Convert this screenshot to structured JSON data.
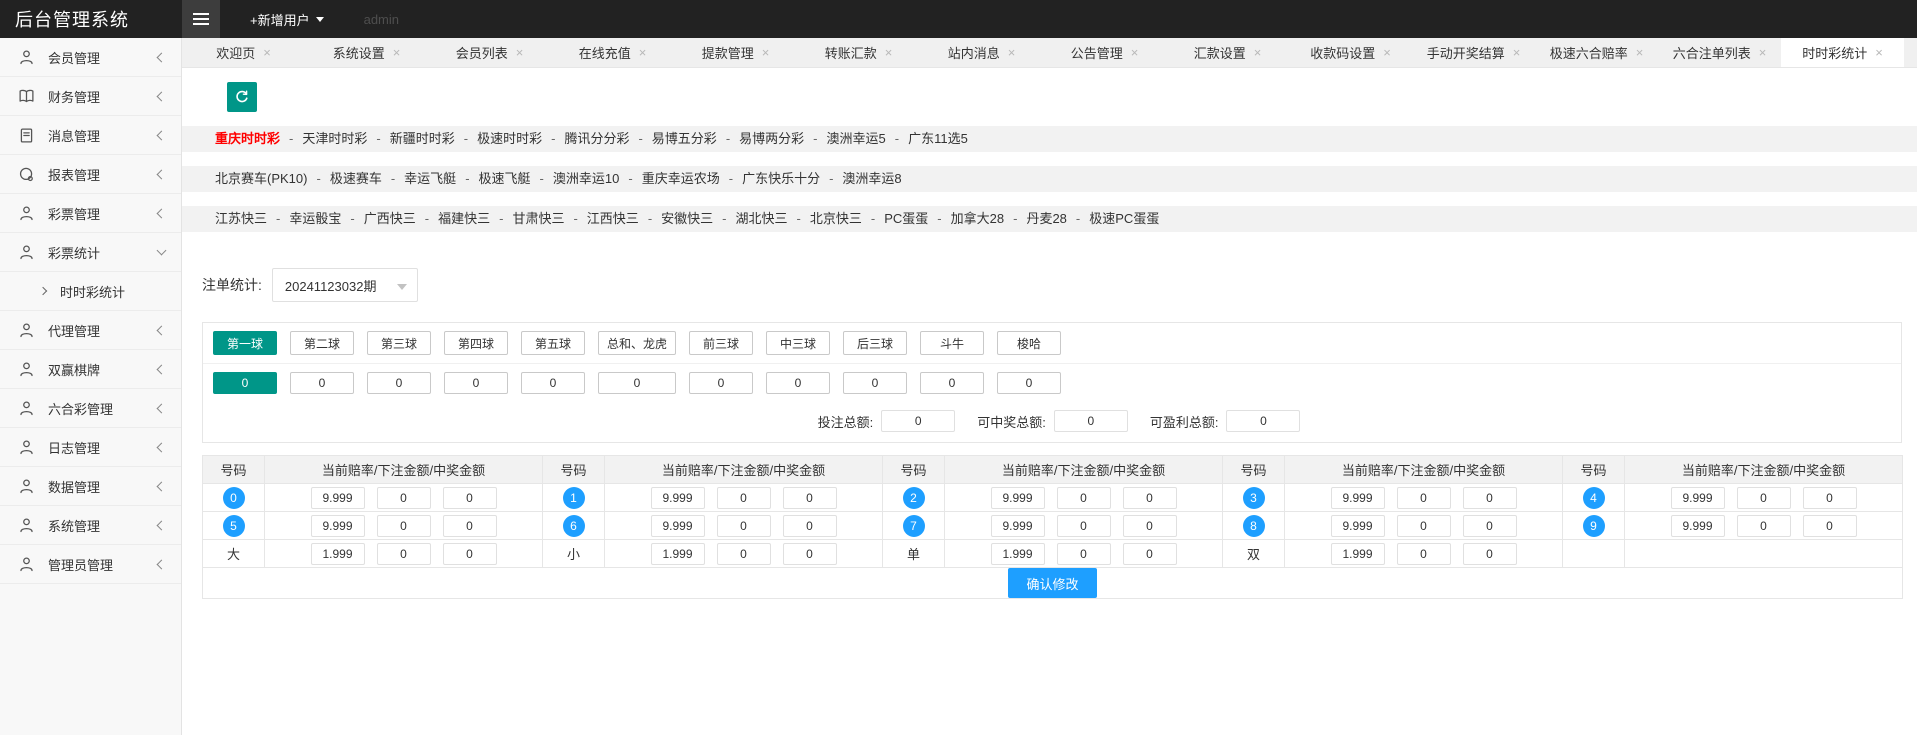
{
  "colors": {
    "accent_teal": "#009688",
    "accent_blue": "#1E9FFF",
    "active_red": "#ff0000",
    "header_bg": "#222222"
  },
  "header": {
    "title": "后台管理系统",
    "add_user_label": "+新增用户",
    "username": "admin"
  },
  "sidebar": {
    "items": [
      {
        "label": "会员管理",
        "icon": "user-icon",
        "state": "collapsed"
      },
      {
        "label": "财务管理",
        "icon": "book-icon",
        "state": "collapsed"
      },
      {
        "label": "消息管理",
        "icon": "file-icon",
        "state": "collapsed"
      },
      {
        "label": "报表管理",
        "icon": "chart-icon",
        "state": "collapsed"
      },
      {
        "label": "彩票管理",
        "icon": "user-icon",
        "state": "collapsed"
      },
      {
        "label": "彩票统计",
        "icon": "user-icon",
        "state": "expanded",
        "children": [
          {
            "label": "时时彩统计"
          }
        ]
      },
      {
        "label": "代理管理",
        "icon": "user-icon",
        "state": "collapsed"
      },
      {
        "label": "双赢棋牌",
        "icon": "user-icon",
        "state": "collapsed"
      },
      {
        "label": "六合彩管理",
        "icon": "user-icon",
        "state": "collapsed"
      },
      {
        "label": "日志管理",
        "icon": "user-icon",
        "state": "collapsed"
      },
      {
        "label": "数据管理",
        "icon": "user-icon",
        "state": "collapsed"
      },
      {
        "label": "系统管理",
        "icon": "user-icon",
        "state": "collapsed"
      },
      {
        "label": "管理员管理",
        "icon": "user-icon",
        "state": "collapsed"
      }
    ]
  },
  "tab_bar": {
    "tabs": [
      {
        "label": "欢迎页",
        "active": false
      },
      {
        "label": "系统设置",
        "active": false
      },
      {
        "label": "会员列表",
        "active": false
      },
      {
        "label": "在线充值",
        "active": false
      },
      {
        "label": "提款管理",
        "active": false
      },
      {
        "label": "转账汇款",
        "active": false
      },
      {
        "label": "站内消息",
        "active": false
      },
      {
        "label": "公告管理",
        "active": false
      },
      {
        "label": "汇款设置",
        "active": false
      },
      {
        "label": "收款码设置",
        "active": false
      },
      {
        "label": "手动开奖结算",
        "active": false
      },
      {
        "label": "极速六合赔率",
        "active": false
      },
      {
        "label": "六合注单列表",
        "active": false
      },
      {
        "label": "时时彩统计",
        "active": true
      }
    ],
    "close_glyph": "×"
  },
  "lottery_nav": {
    "separator": "-",
    "rows": [
      {
        "active": "重庆时时彩",
        "links": [
          "重庆时时彩",
          "天津时时彩",
          "新疆时时彩",
          "极速时时彩",
          "腾讯分分彩",
          "易博五分彩",
          "易博两分彩",
          "澳洲幸运5",
          "广东11选5"
        ]
      },
      {
        "active": null,
        "links": [
          "北京赛车(PK10)",
          "极速赛车",
          "幸运飞艇",
          "极速飞艇",
          "澳洲幸运10",
          "重庆幸运农场",
          "广东快乐十分",
          "澳洲幸运8"
        ]
      },
      {
        "active": null,
        "links": [
          "江苏快三",
          "幸运骰宝",
          "广西快三",
          "福建快三",
          "甘肃快三",
          "江西快三",
          "安徽快三",
          "湖北快三",
          "北京快三",
          "PC蛋蛋",
          "加拿大28",
          "丹麦28",
          "极速PC蛋蛋"
        ]
      }
    ]
  },
  "period": {
    "label": "注单统计:",
    "selected": "20241123032期"
  },
  "ball_panel": {
    "tabs": [
      "第一球",
      "第二球",
      "第三球",
      "第四球",
      "第五球",
      "总和、龙虎",
      "前三球",
      "中三球",
      "后三球",
      "斗牛",
      "梭哈"
    ],
    "active_index": 0,
    "totals": [
      "0",
      "0",
      "0",
      "0",
      "0",
      "0",
      "0",
      "0",
      "0",
      "0",
      "0"
    ],
    "summary": [
      {
        "label": "投注总额:",
        "value": "0"
      },
      {
        "label": "可中奖总额:",
        "value": "0"
      },
      {
        "label": "可盈利总额:",
        "value": "0"
      }
    ]
  },
  "odds_table": {
    "col_headers": {
      "number": "号码",
      "odds": "当前赔率/下注金额/中奖金额"
    },
    "rows": [
      [
        {
          "num": "0",
          "badge": true,
          "odds": "9.999",
          "bet": "0",
          "win": "0"
        },
        {
          "num": "1",
          "badge": true,
          "odds": "9.999",
          "bet": "0",
          "win": "0"
        },
        {
          "num": "2",
          "badge": true,
          "odds": "9.999",
          "bet": "0",
          "win": "0"
        },
        {
          "num": "3",
          "badge": true,
          "odds": "9.999",
          "bet": "0",
          "win": "0"
        },
        {
          "num": "4",
          "badge": true,
          "odds": "9.999",
          "bet": "0",
          "win": "0"
        }
      ],
      [
        {
          "num": "5",
          "badge": true,
          "odds": "9.999",
          "bet": "0",
          "win": "0"
        },
        {
          "num": "6",
          "badge": true,
          "odds": "9.999",
          "bet": "0",
          "win": "0"
        },
        {
          "num": "7",
          "badge": true,
          "odds": "9.999",
          "bet": "0",
          "win": "0"
        },
        {
          "num": "8",
          "badge": true,
          "odds": "9.999",
          "bet": "0",
          "win": "0"
        },
        {
          "num": "9",
          "badge": true,
          "odds": "9.999",
          "bet": "0",
          "win": "0"
        }
      ],
      [
        {
          "num": "大",
          "badge": false,
          "odds": "1.999",
          "bet": "0",
          "win": "0"
        },
        {
          "num": "小",
          "badge": false,
          "odds": "1.999",
          "bet": "0",
          "win": "0"
        },
        {
          "num": "单",
          "badge": false,
          "odds": "1.999",
          "bet": "0",
          "win": "0"
        },
        {
          "num": "双",
          "badge": false,
          "odds": "1.999",
          "bet": "0",
          "win": "0"
        },
        null
      ]
    ],
    "confirm_button": "确认修改"
  }
}
